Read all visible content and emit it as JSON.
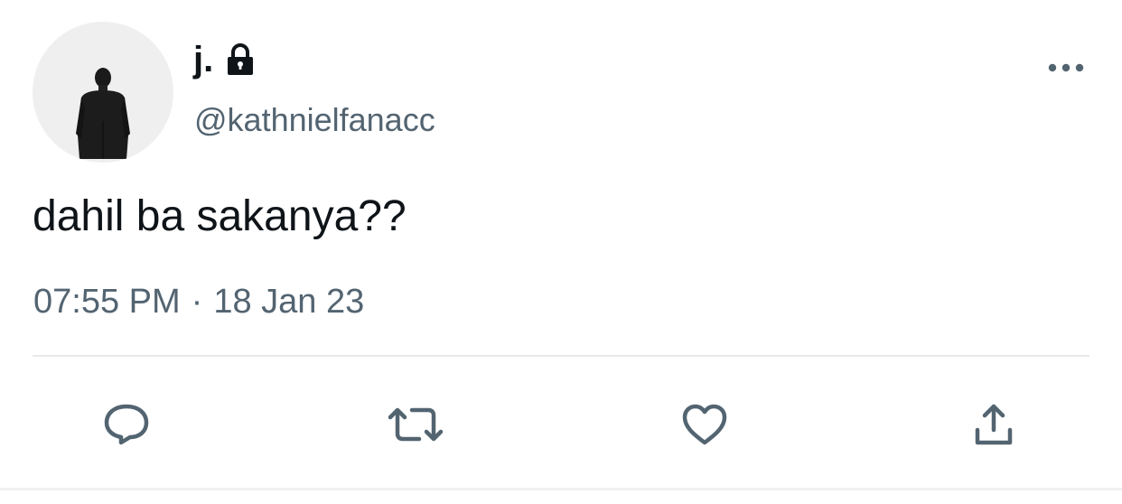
{
  "user": {
    "display_name": "j.",
    "handle": "@kathnielfanacc",
    "protected": true,
    "avatar": "person-in-suit-back-view"
  },
  "tweet": {
    "text": "dahil ba sakanya??",
    "time": "07:55 PM",
    "separator": "·",
    "date": "18 Jan 23"
  },
  "actions": [
    {
      "name": "reply",
      "icon": "speech-bubble-icon"
    },
    {
      "name": "retweet",
      "icon": "retweet-icon"
    },
    {
      "name": "like",
      "icon": "heart-icon"
    },
    {
      "name": "share",
      "icon": "share-upload-icon"
    }
  ],
  "colors": {
    "text_primary": "#0f1419",
    "text_secondary": "#536471",
    "icon": "#536471",
    "divider": "#e6e9eb",
    "background": "#ffffff"
  }
}
